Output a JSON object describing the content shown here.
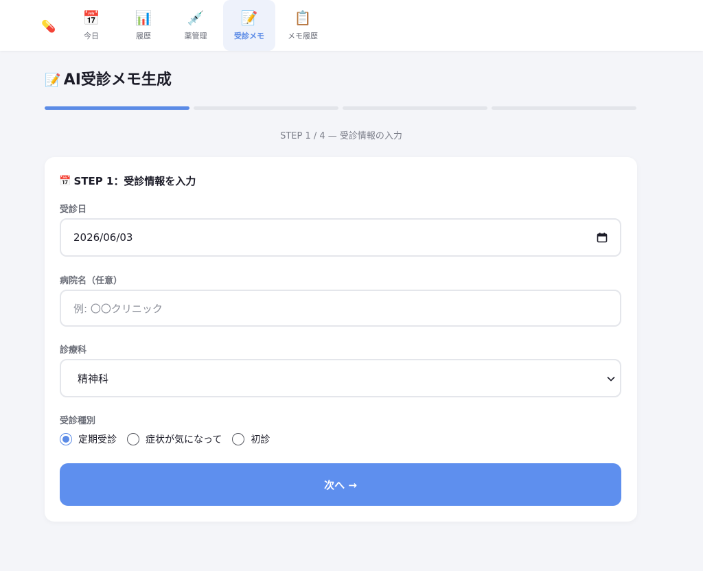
{
  "nav": {
    "brand_icon": "pill-icon",
    "tabs": [
      {
        "label": "今日",
        "icon": "calendar-icon",
        "glyph": "📅"
      },
      {
        "label": "履歴",
        "icon": "bar-chart-icon",
        "glyph": "📊"
      },
      {
        "label": "薬管理",
        "icon": "syringe-icon",
        "glyph": "💉"
      },
      {
        "label": "受診メモ",
        "icon": "memo-icon",
        "glyph": "📝",
        "active": true
      },
      {
        "label": "メモ履歴",
        "icon": "clipboard-icon",
        "glyph": "📋"
      }
    ]
  },
  "page": {
    "title": "AI受診メモ生成",
    "title_icon": "memo-icon",
    "step_caption": "STEP 1 / 4 — 受診情報の入力",
    "progress": {
      "current_step": 1,
      "total_steps": 4
    }
  },
  "card": {
    "title": "STEP 1：受診情報を入力",
    "title_icon": "calendar-icon",
    "visit_date": {
      "label": "受診日",
      "value": "2026/06/03"
    },
    "hospital": {
      "label": "病院名（任意）",
      "placeholder": "例: 〇〇クリニック"
    },
    "department": {
      "label": "診療科",
      "selected": "精神科"
    },
    "visit_type": {
      "label": "受診種別",
      "options": [
        "定期受診",
        "症状が気になって",
        "初診"
      ],
      "selected": "定期受診"
    },
    "next_button": "次へ →"
  },
  "colors": {
    "accent": "#5e8fee",
    "progress_done": "#5b8be6",
    "progress_todo": "#e3e5ea",
    "background": "#f4f5f9",
    "active_tab_bg": "#eef2fb"
  }
}
